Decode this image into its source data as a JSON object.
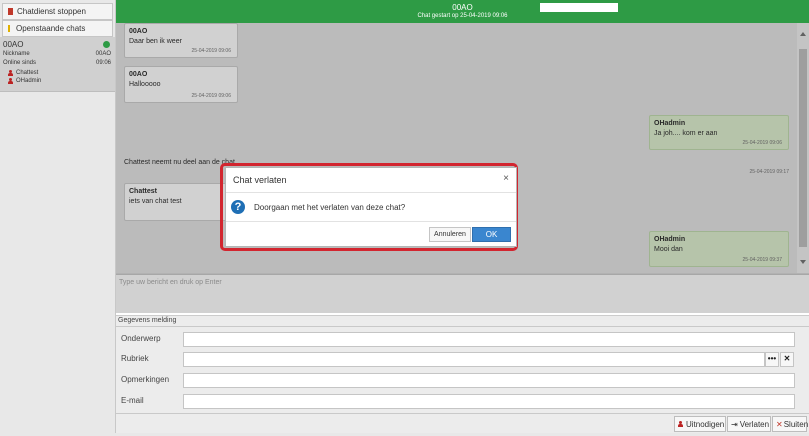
{
  "sidebar": {
    "stop_button": "Chatdienst stoppen",
    "open_chats_button": "Openstaande chats",
    "session": {
      "name": "00AO",
      "nickname_label": "Nickname",
      "nickname_value": "00AO",
      "online_label": "Online sinds",
      "online_value": "09:06",
      "users": [
        "Chattest",
        "OHadmin"
      ],
      "status_color": "#2e9b45"
    }
  },
  "header": {
    "title": "00AO",
    "subtitle": "Chat gestart op 25-04-2019 09:06",
    "color": "#2e9b45"
  },
  "messages": [
    {
      "sender": "00AO",
      "text": "Daar ben ik weer",
      "time": "25-04-2019 09:06"
    },
    {
      "sender": "00AO",
      "text": "Hallooooo",
      "time": "25-04-2019 09:06"
    },
    {
      "sender": "OHadmin",
      "text": "Ja joh.... kom er aan",
      "time": "25-04-2019 09:06"
    },
    {
      "sender": "Chattest",
      "text": "iets van chat test",
      "time": ""
    },
    {
      "sender": "OHadmin",
      "text": "Mooi dan",
      "time": "25-04-2019 09:37"
    }
  ],
  "notice": {
    "text": "Chattest neemt nu deel aan de chat",
    "time": "25-04-2019 09:17"
  },
  "composer": {
    "placeholder": "Type uw bericht en druk op Enter"
  },
  "form": {
    "legend": "Gegevens melding",
    "subject_label": "Onderwerp",
    "category_label": "Rubriek",
    "remarks_label": "Opmerkingen",
    "email_label": "E-mail",
    "more_button": "•••",
    "clear_button": "✕"
  },
  "actions": {
    "invite": "Uitnodigen",
    "leave": "Verlaten",
    "close": "Sluiten"
  },
  "dialog": {
    "title": "Chat verlaten",
    "question": "Doorgaan met het verlaten van deze chat?",
    "cancel": "Annuleren",
    "ok": "OK",
    "close_glyph": "×",
    "accent": "#3a86cf",
    "highlight": "#d2252f"
  }
}
